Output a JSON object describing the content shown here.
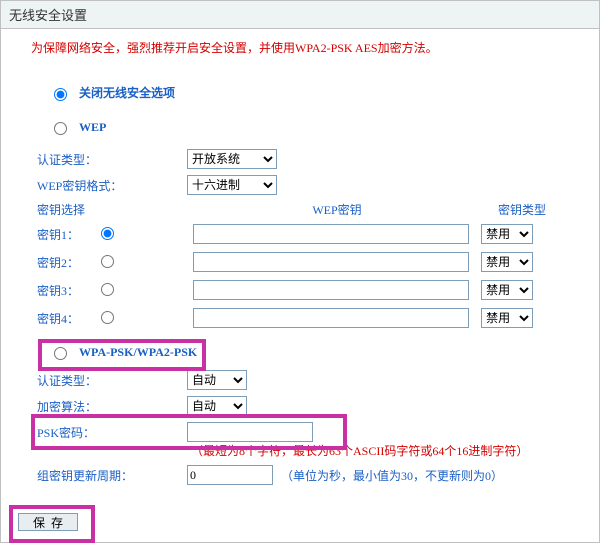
{
  "title": "无线安全设置",
  "warning": "为保障网络安全，强烈推荐开启安全设置，并使用WPA2-PSK AES加密方法。",
  "disableSecurity": {
    "label": "关闭无线安全选项"
  },
  "wep": {
    "label": "WEP",
    "authLabel": "认证类型：",
    "authValue": "开放系统",
    "keyFormatLabel": "WEP密钥格式：",
    "keyFormatValue": "十六进制",
    "keySelectLabel": "密钥选择",
    "wepKeyHeader": "WEP密钥",
    "keyTypeHeader": "密钥类型",
    "rows": [
      {
        "label": "密钥1：",
        "value": "",
        "type": "禁用",
        "checked": true
      },
      {
        "label": "密钥2：",
        "value": "",
        "type": "禁用",
        "checked": false
      },
      {
        "label": "密钥3：",
        "value": "",
        "type": "禁用",
        "checked": false
      },
      {
        "label": "密钥4：",
        "value": "",
        "type": "禁用",
        "checked": false
      }
    ]
  },
  "wpa": {
    "label": "WPA-PSK/WPA2-PSK",
    "authLabel": "认证类型：",
    "authValue": "自动",
    "encLabel": "加密算法：",
    "encValue": "自动",
    "pskLabel": "PSK密码：",
    "pskValue": "",
    "pskNote": "（最短为8个字符，最长为63个ASCII码字符或64个16进制字符）",
    "groupKeyLabel": "组密钥更新周期：",
    "groupKeyValue": "0",
    "groupKeyUnit": "（单位为秒，最小值为30，不更新则为0）"
  },
  "saveLabel": "保存"
}
